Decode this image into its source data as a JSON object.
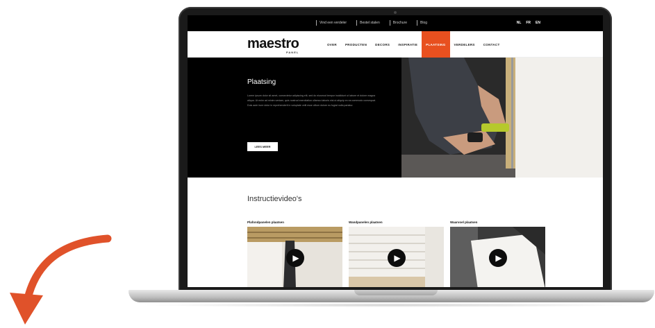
{
  "topbar": {
    "links": [
      "Vind een verdeler",
      "Bestel stalen",
      "Brochure",
      "Blog"
    ],
    "languages": [
      "NL",
      "FR",
      "EN"
    ]
  },
  "header": {
    "logo": "maestro",
    "logo_sub": "PANEL",
    "nav": [
      "OVER",
      "PRODUCTEN",
      "DECORS",
      "INSPIRATIE",
      "PLAATSING",
      "VERDELERS",
      "CONTACT"
    ],
    "active_nav": "PLAATSING"
  },
  "hero": {
    "title": "Plaatsing",
    "body": "Lorem ipsum dolor sit amet, consectetur adipiscing elit, sed do eiusmod tempor incididunt ut labore et dolore magna aliqua. Ut enim ad minim veniam, quis nostrud exercitation ullamco laboris nisi ut aliquip ex ea commodo consequat. Duis aute irure dolor in reprehenderit in voluptate velit esse cillum dolore eu fugiat nulla pariatur.",
    "button_label": "LEES MEER"
  },
  "videos": {
    "title": "Instructievideo's",
    "cards": [
      {
        "title": "Plafondpanelen plaatsen"
      },
      {
        "title": "Wandpanelen plaatsen"
      },
      {
        "title": "Waarvoel plaatsen"
      }
    ]
  },
  "colors": {
    "accent": "#e8501f",
    "topbar": "#000000",
    "hero": "#000000"
  }
}
